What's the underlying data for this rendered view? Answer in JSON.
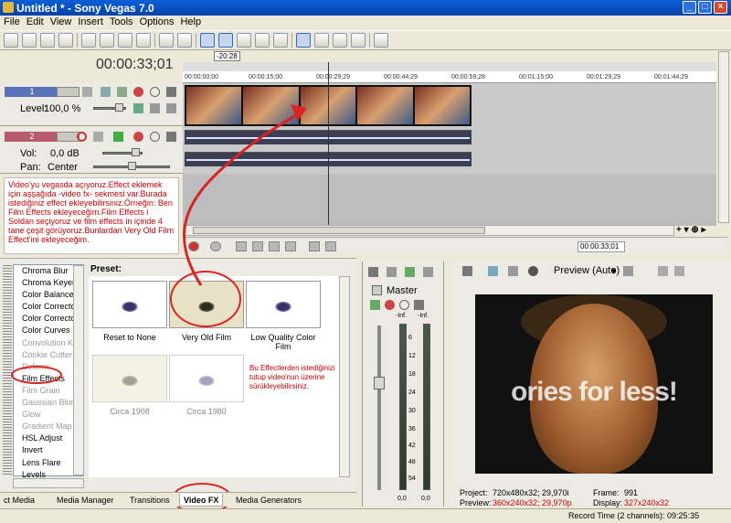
{
  "window": {
    "title": "Untitled * - Sony Vegas 7.0",
    "min": "_",
    "max": "□",
    "close": "×"
  },
  "menu": [
    "File",
    "Edit",
    "View",
    "Insert",
    "Tools",
    "Options",
    "Help"
  ],
  "timeline": {
    "timecode": "00:00:33;01",
    "cursor_badge": "-20:28",
    "ruler_ticks": [
      "00:00:00;00",
      "00:00:15;00",
      "00:00:29;29",
      "00:00:44;29",
      "00:00:59;28",
      "00:01:15;00",
      "00:01:29;29",
      "00:01:44;29"
    ],
    "end_timecode": "00:00:33;01"
  },
  "video_track": {
    "number": "1",
    "level_label": "Level:",
    "level_value": "100,0 %"
  },
  "audio_track": {
    "number": "2",
    "vol_label": "Vol:",
    "vol_value": "0,0 dB",
    "pan_label": "Pan:",
    "pan_value": "Center"
  },
  "annotation": "Video'yu vegasda açıyoruz.Effect eklemek için aşşağıda -video fx- sekmesi var.Burada istediğiniz effect ekleyebilirsiniz.Örneğin: Ben Film Effects ekleyeceğim.Film Effects i Soldan seçiyoruz ve film effects in içinde 4 tane çeşit görüyoruz.Bunlardan Very Old Film Effect'ini ekleyeceğim.",
  "fx_list": [
    {
      "label": "Chroma Blur",
      "dim": false
    },
    {
      "label": "Chroma Keyer",
      "dim": false
    },
    {
      "label": "Color Balance",
      "dim": false
    },
    {
      "label": "Color Corrector",
      "dim": false
    },
    {
      "label": "Color Corrector (Secondary)",
      "dim": false
    },
    {
      "label": "Color Curves",
      "dim": false
    },
    {
      "label": "Convolution Kernel",
      "dim": true
    },
    {
      "label": "Cookie Cutter",
      "dim": true
    },
    {
      "label": "Deform",
      "dim": true
    },
    {
      "label": "Film Effects",
      "dim": false
    },
    {
      "label": "Film Grain",
      "dim": true
    },
    {
      "label": "Gaussian Blur",
      "dim": true
    },
    {
      "label": "Glow",
      "dim": true
    },
    {
      "label": "Gradient Map",
      "dim": true
    },
    {
      "label": "HSL Adjust",
      "dim": false
    },
    {
      "label": "Invert",
      "dim": false
    },
    {
      "label": "Lens Flare",
      "dim": false
    },
    {
      "label": "Levels",
      "dim": false
    }
  ],
  "preset": {
    "label": "Preset:",
    "items": [
      "Reset to None",
      "Very Old Film",
      "Low Quality Color Film",
      "Circa 1908",
      "Circa 1980"
    ],
    "note": "Bu Effectlerden istediğinizi tutup video'nun üzerine sürükleyebilirsiniz."
  },
  "tabs": [
    "ct Media",
    "Media Manager",
    "Transitions",
    "Video FX",
    "Media Generators"
  ],
  "active_tab": "Video FX",
  "mixer": {
    "title": "Master",
    "inf_left": "-Inf.",
    "inf_right": "-Inf.",
    "scale": [
      "6",
      "12",
      "18",
      "24",
      "30",
      "36",
      "42",
      "48",
      "54"
    ],
    "val_left": "0,0",
    "val_right": "0,0"
  },
  "preview": {
    "mode": "Preview (Auto)",
    "overlay_text": "ories for less!",
    "project_label": "Project:",
    "project_value": "720x480x32; 29,970i",
    "preview_label": "Preview:",
    "preview_value": "360x240x32; 29,970p",
    "frame_label": "Frame:",
    "frame_value": "991",
    "display_label": "Display:",
    "display_value": "327x240x32"
  },
  "status": "Record Time (2 channels): 09:25:35",
  "colors": {
    "annotation_red": "#cc0000",
    "track_video": "#5a72b8",
    "track_audio": "#b85a6e"
  }
}
